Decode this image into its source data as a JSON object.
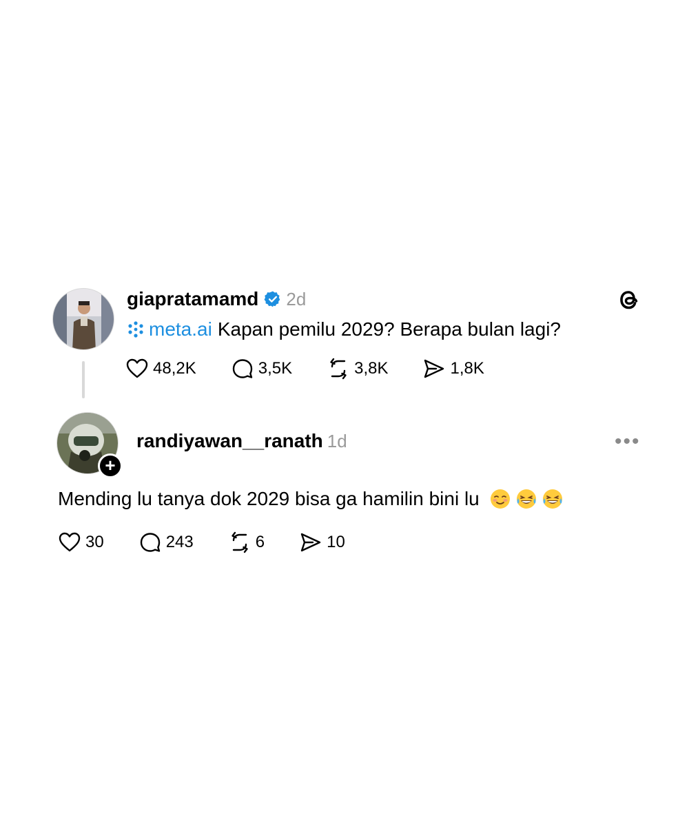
{
  "op": {
    "username": "giapratamamd",
    "time": "2d",
    "mention": "meta.ai",
    "text": "Kapan pemilu 2029? Berapa bulan lagi?",
    "stats": {
      "likes": "48,2K",
      "replies": "3,5K",
      "reposts": "3,8K",
      "shares": "1,8K"
    }
  },
  "reply": {
    "username": "randiyawan__ranath",
    "time": "1d",
    "text": "Mending lu tanya dok 2029 bisa ga hamilin bini lu",
    "emojis": [
      "relieved-face",
      "tears-of-joy",
      "tears-of-joy"
    ],
    "stats": {
      "likes": "30",
      "replies": "243",
      "reposts": "6",
      "shares": "10"
    }
  },
  "icons": {
    "more": "•••",
    "follow": "+"
  },
  "colors": {
    "mention": "#1d8fe0",
    "verified": "#1d8fe0",
    "muted": "#9a9a9a"
  }
}
